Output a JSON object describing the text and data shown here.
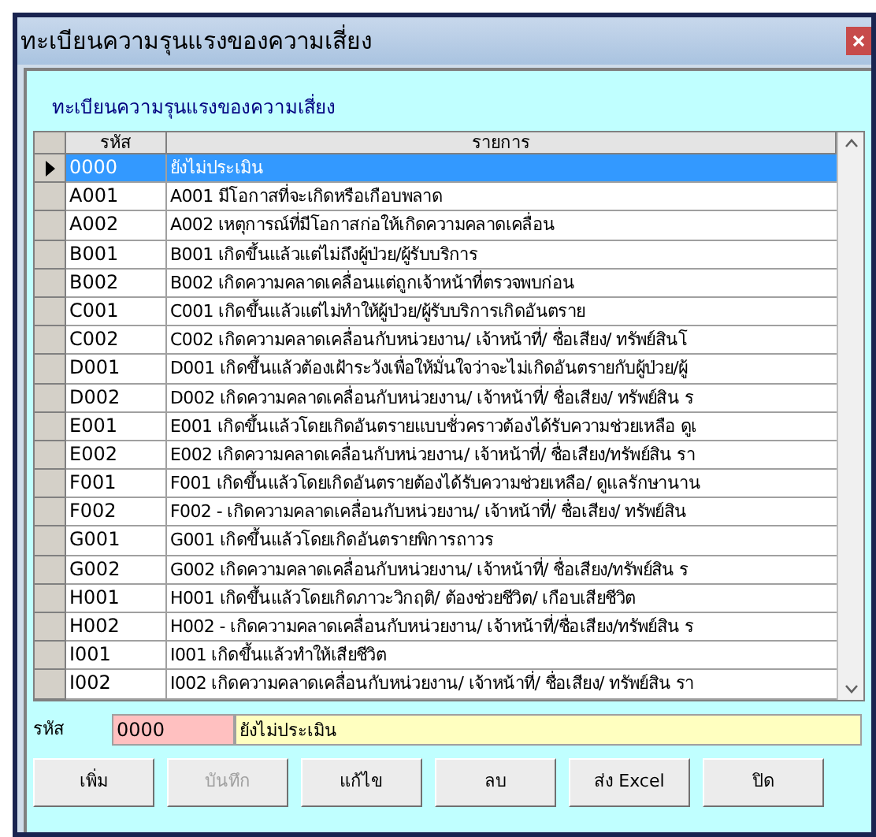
{
  "window": {
    "title": "ทะเบียนความรุนแรงของความเสี่ยง"
  },
  "heading": "ทะเบียนความรุนแรงของความเสี่ยง",
  "table": {
    "columns": [
      "รหัส",
      "รายการ"
    ],
    "rows": [
      {
        "code": "0000",
        "description": "ยังไม่ประเมิน",
        "selected": true
      },
      {
        "code": "A001",
        "description": "A001 มีโอกาสที่จะเกิดหรือเกือบพลาด",
        "selected": false
      },
      {
        "code": "A002",
        "description": "A002 เหตุการณ์ที่มีโอกาสก่อให้เกิดความคลาดเคลื่อน",
        "selected": false
      },
      {
        "code": "B001",
        "description": "B001 เกิดขึ้นแล้วแต่ไม่ถึงผู้ป่วย/ผู้รับบริการ",
        "selected": false
      },
      {
        "code": "B002",
        "description": "B002 เกิดความคลาดเคลื่อนแต่ถูกเจ้าหน้าที่ตรวจพบก่อน",
        "selected": false
      },
      {
        "code": "C001",
        "description": "C001 เกิดขึ้นแล้วแต่ไม่ทำให้ผู้ป่วย/ผู้รับบริการเกิดอันตราย",
        "selected": false
      },
      {
        "code": "C002",
        "description": "C002 เกิดความคลาดเคลื่อนกับหน่วยงาน/ เจ้าหน้าที่/ ชื่อเสียง/ ทรัพย์สินโ",
        "selected": false
      },
      {
        "code": "D001",
        "description": "D001 เกิดขึ้นแล้วต้องเฝ้าระวังเพื่อให้มั่นใจว่าจะไม่เกิดอันตรายกับผู้ป่วย/ผู้",
        "selected": false
      },
      {
        "code": "D002",
        "description": "D002 เกิดความคลาดเคลื่อนกับหน่วยงาน/ เจ้าหน้าที่/ ชื่อเสียง/ ทรัพย์สิน ร",
        "selected": false
      },
      {
        "code": "E001",
        "description": "E001 เกิดขึ้นแล้วโดยเกิดอันตรายแบบชั่วคราวต้องได้รับความช่วยเหลือ ดูเ",
        "selected": false
      },
      {
        "code": "E002",
        "description": "E002 เกิดความคลาดเคลื่อนกับหน่วยงาน/ เจ้าหน้าที่/ ชื่อเสียง/ทรัพย์สิน รา",
        "selected": false
      },
      {
        "code": "F001",
        "description": "F001 เกิดขึ้นแล้วโดยเกิดอันตรายต้องได้รับความช่วยเหลือ/ ดูแลรักษานาน",
        "selected": false
      },
      {
        "code": "F002",
        "description": "F002 - เกิดความคลาดเคลื่อนกับหน่วยงาน/ เจ้าหน้าที่/ ชื่อเสียง/ ทรัพย์สิน",
        "selected": false
      },
      {
        "code": "G001",
        "description": "G001 เกิดขึ้นแล้วโดยเกิดอันตรายพิการถาวร",
        "selected": false
      },
      {
        "code": "G002",
        "description": "G002 เกิดความคลาดเคลื่อนกับหน่วยงาน/ เจ้าหน้าที่/ ชื่อเสียง/ทรัพย์สิน ร",
        "selected": false
      },
      {
        "code": "H001",
        "description": "H001 เกิดขึ้นแล้วโดยเกิดภาวะวิกฤติ/ ต้องช่วยชีวิต/ เกือบเสียชีวิต",
        "selected": false
      },
      {
        "code": "H002",
        "description": "H002 - เกิดความคลาดเคลื่อนกับหน่วยงาน/ เจ้าหน้าที่/ชื่อเสียง/ทรัพย์สิน ร",
        "selected": false
      },
      {
        "code": "I001",
        "description": "I001 เกิดขึ้นแล้วทำให้เสียชีวิต",
        "selected": false
      },
      {
        "code": "I002",
        "description": "I002 เกิดความคลาดเคลื่อนกับหน่วยงาน/ เจ้าหน้าที่/ ชื่อเสียง/ ทรัพย์สิน รา",
        "selected": false
      }
    ]
  },
  "form": {
    "label": "รหัส",
    "code": "0000",
    "description": "ยังไม่ประเมิน"
  },
  "buttons": [
    {
      "label": "เพิ่ม",
      "disabled": false
    },
    {
      "label": "บันทึก",
      "disabled": true
    },
    {
      "label": "แก้ไข",
      "disabled": false
    },
    {
      "label": "ลบ",
      "disabled": false
    },
    {
      "label": "ส่ง Excel",
      "disabled": false
    },
    {
      "label": "ปิด",
      "disabled": false
    }
  ]
}
